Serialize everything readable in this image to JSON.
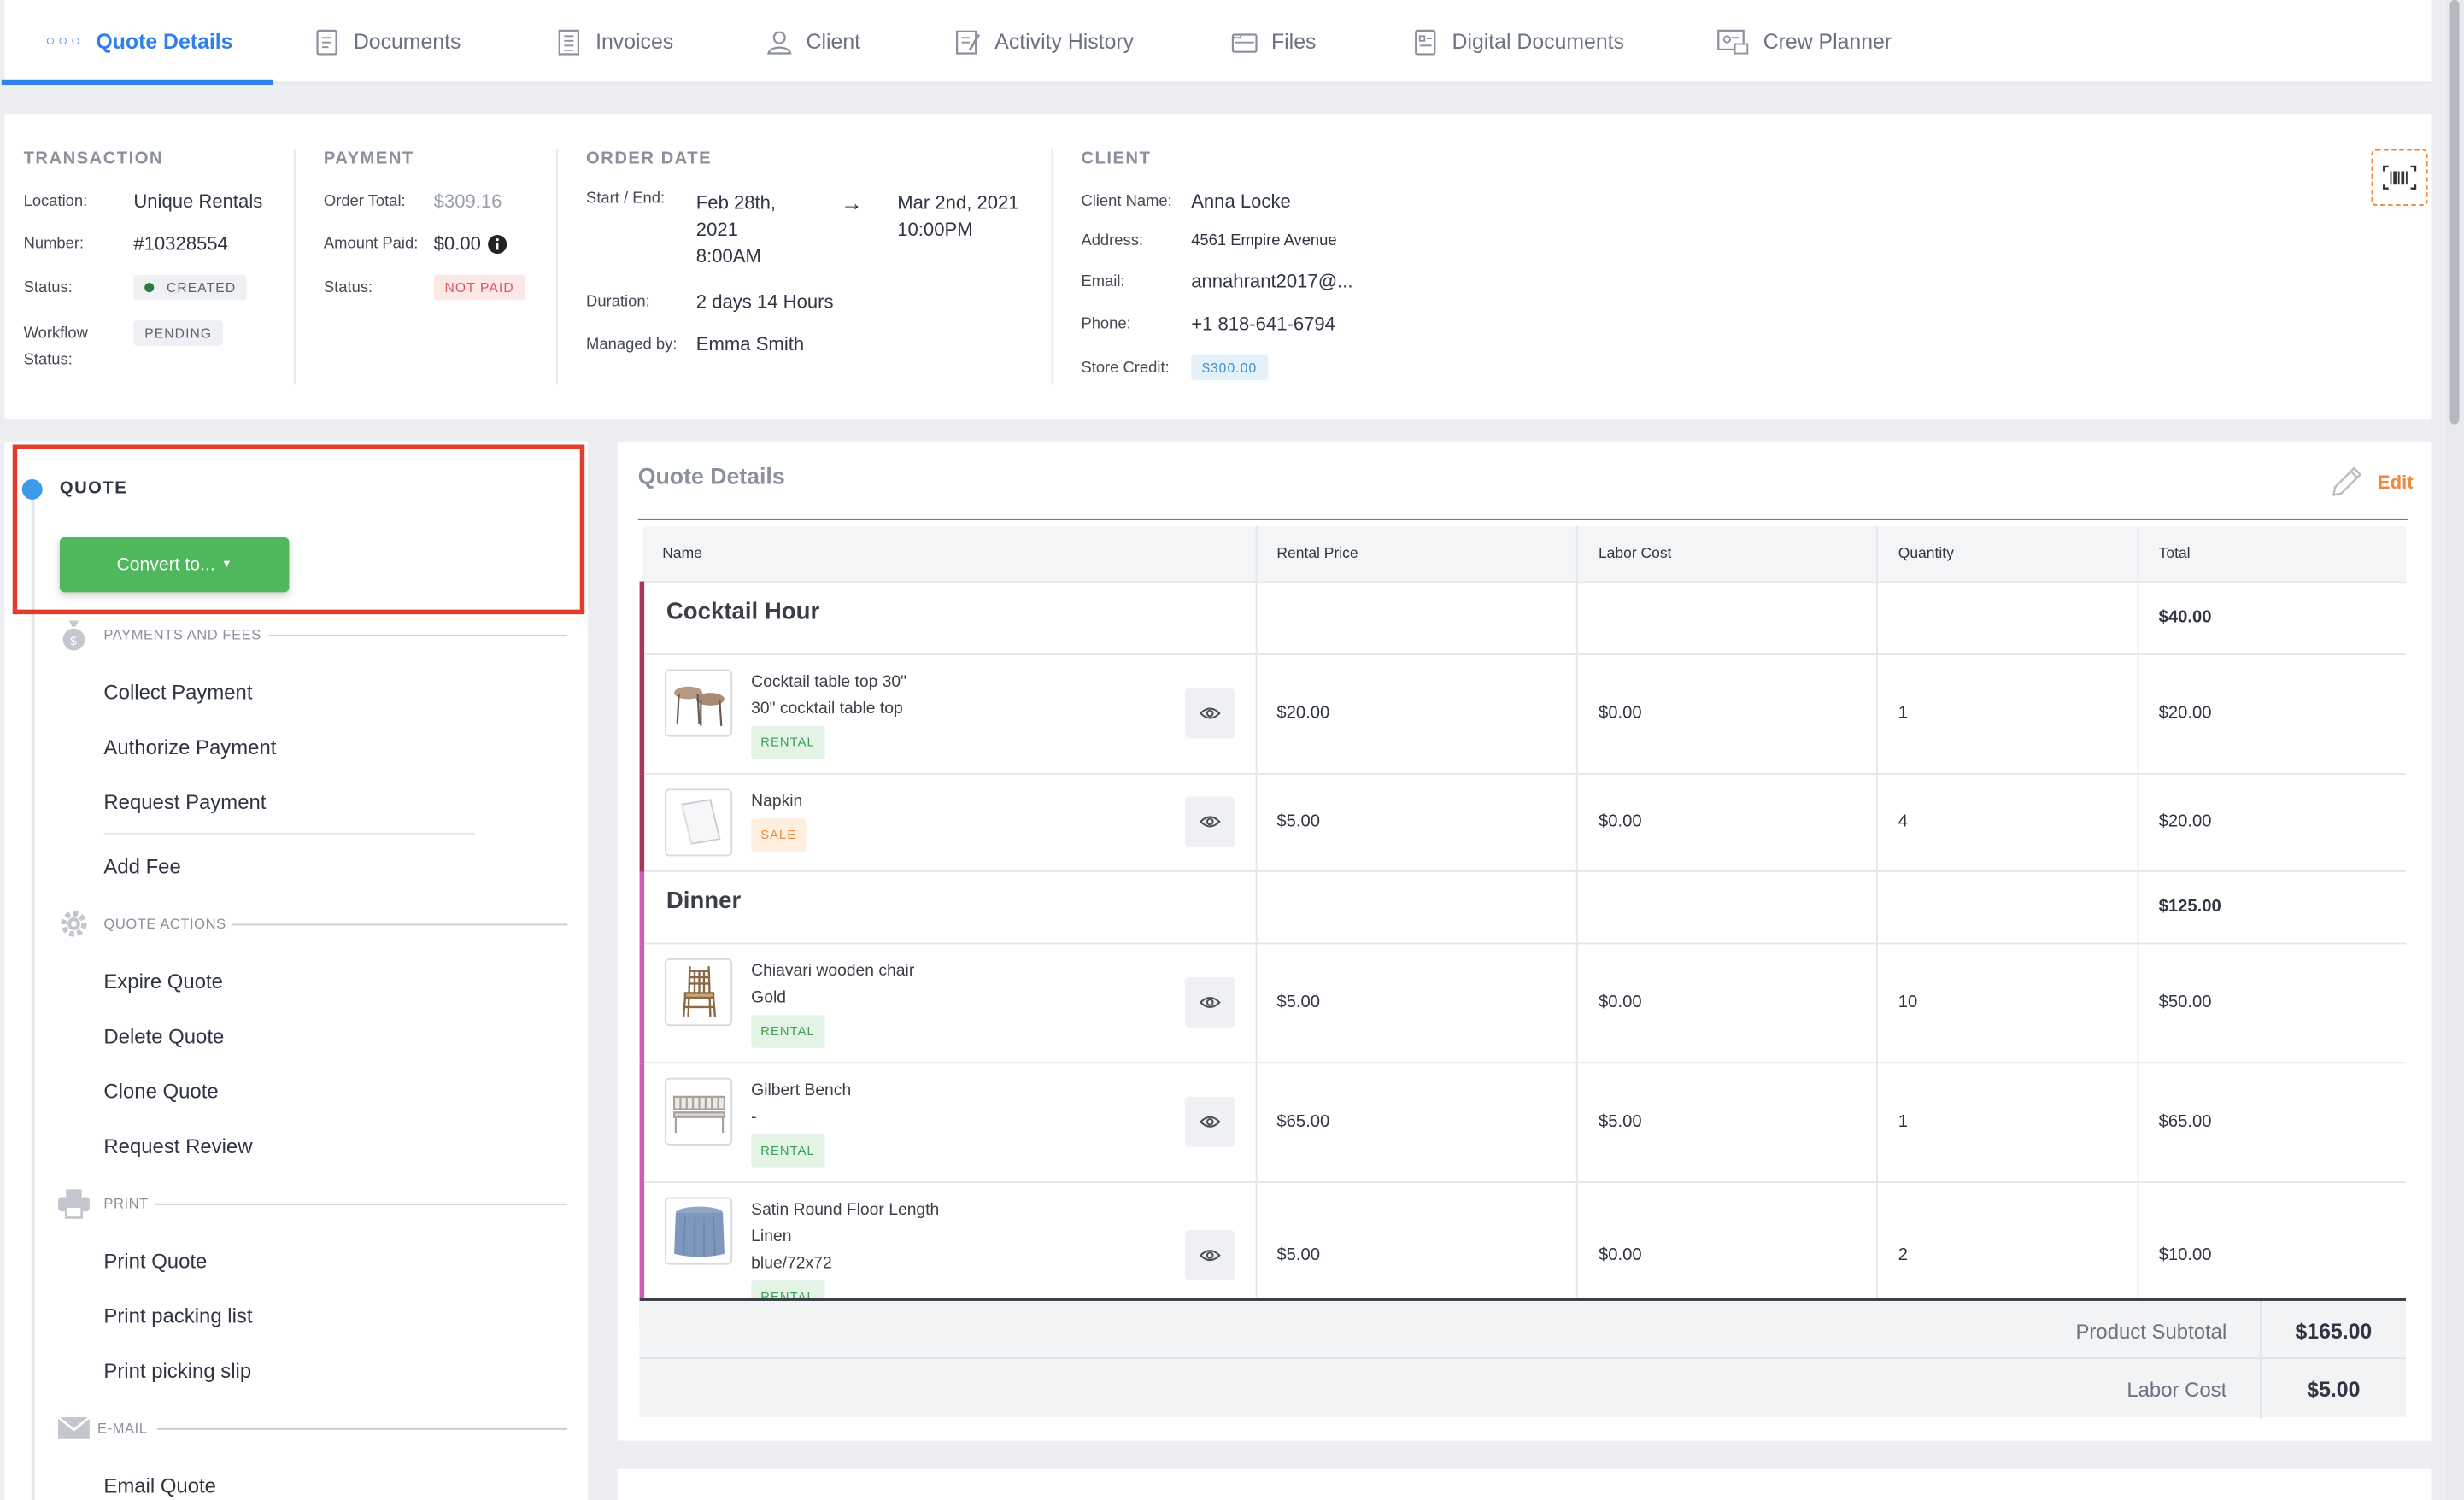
{
  "tabs": [
    {
      "label": "Quote Details",
      "icon": "dots-icon"
    },
    {
      "label": "Documents",
      "icon": "documents-icon"
    },
    {
      "label": "Invoices",
      "icon": "invoice-icon"
    },
    {
      "label": "Client",
      "icon": "client-icon"
    },
    {
      "label": "Activity History",
      "icon": "activity-icon"
    },
    {
      "label": "Files",
      "icon": "files-icon"
    },
    {
      "label": "Digital Documents",
      "icon": "digital-documents-icon"
    },
    {
      "label": "Crew Planner",
      "icon": "crew-planner-icon"
    }
  ],
  "transaction": {
    "heading": "TRANSACTION",
    "location_label": "Location:",
    "location": "Unique Rentals",
    "number_label": "Number:",
    "number": "#10328554",
    "status_label": "Status:",
    "status": "CREATED",
    "workflow_label_1": "Workflow",
    "workflow_label_2": "Status:",
    "workflow": "PENDING"
  },
  "payment": {
    "heading": "PAYMENT",
    "order_total_label": "Order Total:",
    "order_total": "$309.16",
    "amount_paid_label": "Amount Paid:",
    "amount_paid": "$0.00",
    "status_label": "Status:",
    "status": "NOT PAID"
  },
  "order_date": {
    "heading": "ORDER DATE",
    "start_end_label": "Start / End:",
    "start_1": "Feb 28th,",
    "start_2": "2021",
    "start_3": "8:00AM",
    "arrow": "→",
    "end_1": "Mar 2nd, 2021",
    "end_2": "10:00PM",
    "duration_label": "Duration:",
    "duration": "2 days 14 Hours",
    "managed_label": "Managed by:",
    "managed": "Emma Smith"
  },
  "client": {
    "heading": "CLIENT",
    "name_label": "Client Name:",
    "name": "Anna Locke",
    "address_label": "Address:",
    "address": "4561 Empire Avenue",
    "email_label": "Email:",
    "email": "annahrant2017@...",
    "phone_label": "Phone:",
    "phone": "+1 818-641-6794",
    "credit_label": "Store Credit:",
    "credit": "$300.00"
  },
  "sidebar": {
    "quote_label": "QUOTE",
    "convert_label": "Convert to...",
    "sections": {
      "payments": "PAYMENTS AND FEES",
      "quote_actions": "QUOTE ACTIONS",
      "print": "PRINT",
      "email": "E-MAIL"
    },
    "actions": {
      "collect_payment": "Collect Payment",
      "authorize_payment": "Authorize Payment",
      "request_payment": "Request Payment",
      "add_fee": "Add Fee",
      "expire_quote": "Expire Quote",
      "delete_quote": "Delete Quote",
      "clone_quote": "Clone Quote",
      "request_review": "Request Review",
      "print_quote": "Print Quote",
      "print_packing_list": "Print packing list",
      "print_picking_slip": "Print picking slip",
      "email_quote": "Email Quote"
    }
  },
  "quote_details": {
    "title": "Quote Details",
    "edit_label": "Edit",
    "columns": [
      "Name",
      "Rental Price",
      "Labor Cost",
      "Quantity",
      "Total"
    ],
    "groups": [
      {
        "name": "Cocktail Hour",
        "total": "$40.00",
        "items": [
          {
            "line1": "Cocktail table top 30\"",
            "line2": "30\" cocktail table top",
            "line3": "",
            "tag": "RENTAL",
            "thumb": "cocktail-table-thumbnail",
            "price": "$20.00",
            "labor": "$0.00",
            "qty": "1",
            "total": "$20.00"
          },
          {
            "line1": "Napkin",
            "line2": "",
            "line3": "",
            "tag": "SALE",
            "thumb": "napkin-thumbnail",
            "price": "$5.00",
            "labor": "$0.00",
            "qty": "4",
            "total": "$20.00"
          }
        ]
      },
      {
        "name": "Dinner",
        "total": "$125.00",
        "items": [
          {
            "line1": "Chiavari wooden chair",
            "line2": "Gold",
            "line3": "",
            "tag": "RENTAL",
            "thumb": "chair-thumbnail",
            "price": "$5.00",
            "labor": "$0.00",
            "qty": "10",
            "total": "$50.00"
          },
          {
            "line1": "Gilbert Bench",
            "line2": "-",
            "line3": "",
            "tag": "RENTAL",
            "thumb": "bench-thumbnail",
            "price": "$65.00",
            "labor": "$5.00",
            "qty": "1",
            "total": "$65.00"
          },
          {
            "line1": "Satin Round Floor Length",
            "line2": "Linen",
            "line3": "blue/72x72",
            "tag": "RENTAL",
            "thumb": "linen-thumbnail",
            "price": "$5.00",
            "labor": "$0.00",
            "qty": "2",
            "total": "$10.00"
          }
        ]
      }
    ],
    "product_subtotal_label": "Product Subtotal",
    "product_subtotal": "$165.00",
    "labor_cost_label": "Labor Cost",
    "labor_cost": "$5.00"
  },
  "colors": {
    "accent": "#2f80ed",
    "convert_button": "#4fb85d",
    "edit": "#f08a3a",
    "highlight_box": "#e43c2a"
  }
}
